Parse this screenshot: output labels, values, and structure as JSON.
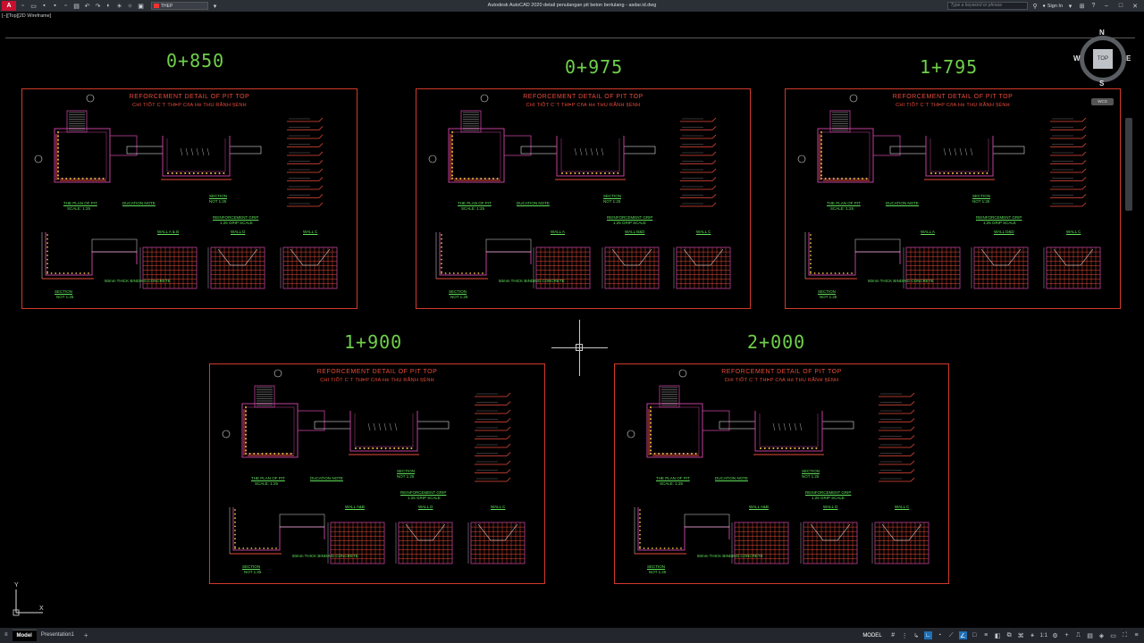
{
  "titlebar": {
    "app_logo": "A",
    "layer_name": "THEP",
    "title": "Autodesk AutoCAD 2020    detail penulangan pit beton bertulang - asdar.id.dwg",
    "search_placeholder": "Type a keyword or phrase",
    "sign_in": "Sign In",
    "help_icon": "?"
  },
  "viewport_label": "[−][Top][2D Wireframe]",
  "viewcube": {
    "face": "TOP",
    "north": "N",
    "south": "S",
    "east": "E",
    "west": "W",
    "wcs": "WCS"
  },
  "stations": [
    "0+850",
    "0+975",
    "1+795",
    "1+900",
    "2+000"
  ],
  "sheet": {
    "title": "REFORCEMENT DETAIL OF PIT TOP",
    "subtitle": "CHI TIÕT C¨T THÞP CñA Hè THU RÃNH §ÉNH",
    "plan_label": "THE PLAN OF PIT",
    "plan_scale": "SCALE: 1:25",
    "section_label": "SECTION",
    "section_scale": "NOT 1:25",
    "grip_label": "REINFORCEMENT GRIP",
    "grip_scale": "1:25 GRIP SCALE",
    "notes_title": "DUCATION NOTE",
    "wall_labels_a": [
      "WALL A & B",
      "WALL D",
      "WALL C"
    ],
    "wall_labels_b": [
      "WALL A",
      "WALL B&D",
      "WALL C"
    ],
    "wall_labels_c": [
      "WALL A",
      "WALL D&D",
      "WALL C"
    ],
    "wall_labels_d": [
      "WALL A&B",
      "WALL D",
      "WALL C"
    ],
    "wall_labels_e": [
      "WALL A&B",
      "WALL D",
      "WALL C"
    ],
    "bedding": "50mm THICK BINDING CONCRETE"
  },
  "tabs": {
    "model": "Model",
    "layout": "Presentation1",
    "add": "+"
  },
  "status": {
    "model": "MODEL",
    "scale": "1:1"
  },
  "ucs": {
    "x": "X",
    "y": "Y"
  }
}
